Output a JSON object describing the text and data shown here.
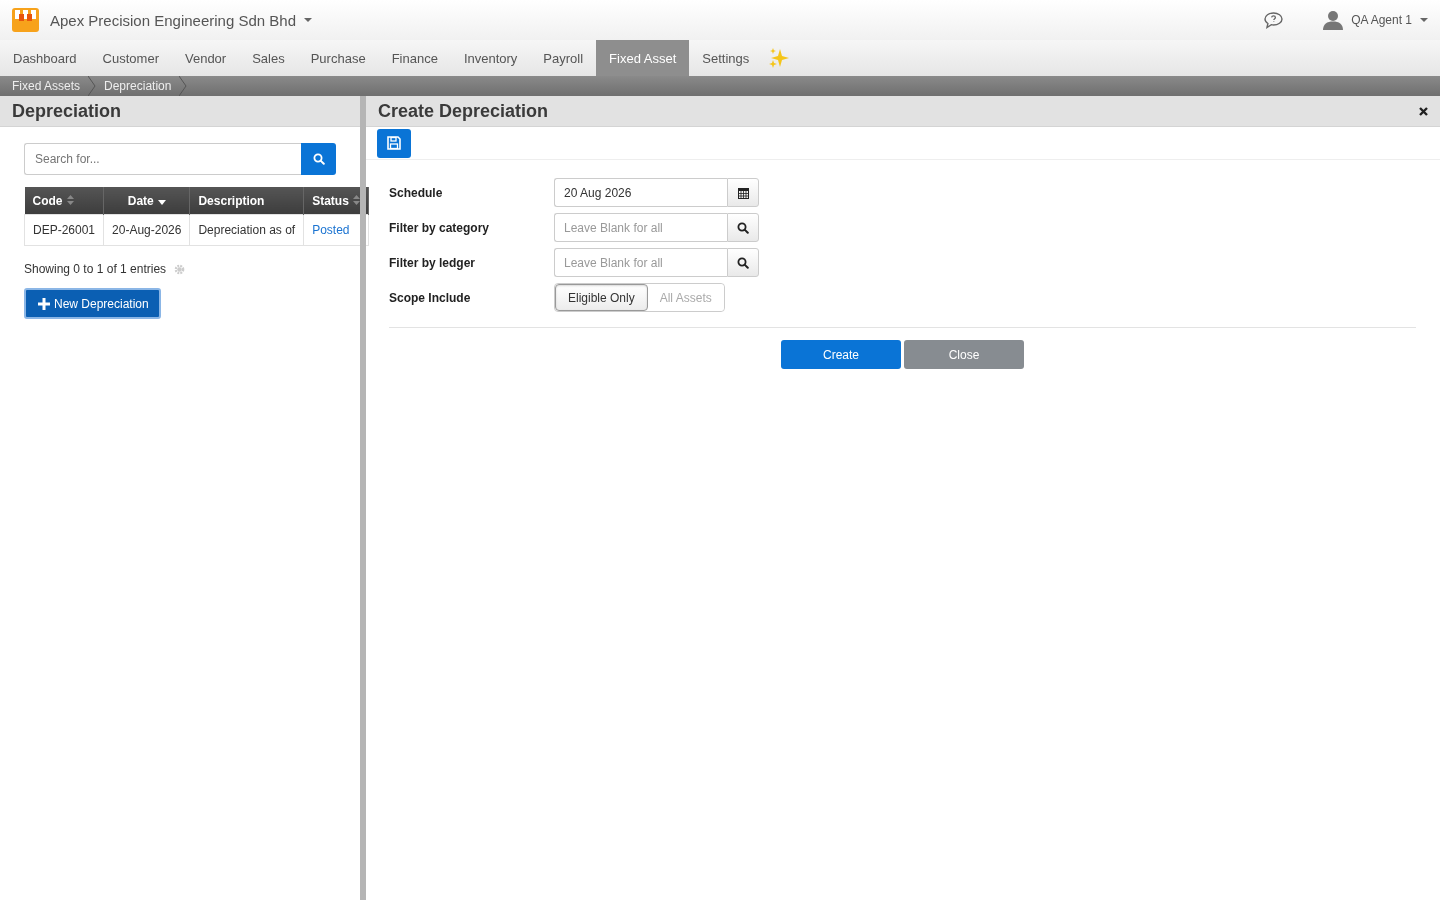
{
  "header": {
    "company": "Apex Precision Engineering Sdn Bhd",
    "user": "QA Agent 1"
  },
  "nav": [
    {
      "label": "Dashboard",
      "selected": false
    },
    {
      "label": "Customer",
      "selected": false
    },
    {
      "label": "Vendor",
      "selected": false
    },
    {
      "label": "Sales",
      "selected": false
    },
    {
      "label": "Purchase",
      "selected": false
    },
    {
      "label": "Finance",
      "selected": false
    },
    {
      "label": "Inventory",
      "selected": false
    },
    {
      "label": "Payroll",
      "selected": false
    },
    {
      "label": "Fixed Asset",
      "selected": true
    },
    {
      "label": "Settings",
      "selected": false
    }
  ],
  "breadcrumb": [
    "Fixed Assets",
    "Depreciation"
  ],
  "list_panel": {
    "title": "Depreciation",
    "search": {
      "placeholder": "Search for..."
    },
    "table": {
      "columns": [
        {
          "label": "Code",
          "sortable": true,
          "sorted_desc": false
        },
        {
          "label": "Date",
          "sortable": true,
          "sorted_desc": true
        },
        {
          "label": "Description",
          "sortable": false
        },
        {
          "label": "Status",
          "sortable": true,
          "sorted_desc": false
        }
      ],
      "rows": [
        {
          "cells": [
            "DEP-26001",
            "20-Aug-2026",
            "Depreciation as of",
            "Posted"
          ]
        }
      ]
    },
    "info": "Showing 0 to 1 of 1 entries",
    "new_button": "New Depreciation"
  },
  "form_panel": {
    "title": "Create Depreciation",
    "fields": [
      {
        "kind": "date",
        "label": "Schedule",
        "value": "20 Aug 2026"
      },
      {
        "kind": "lookup",
        "label": "Filter by category",
        "placeholder": "Leave Blank for all"
      },
      {
        "kind": "lookup",
        "label": "Filter by ledger",
        "placeholder": "Leave Blank for all"
      },
      {
        "kind": "toggle",
        "label": "Scope Include",
        "options": [
          {
            "label": "Eligible Only",
            "selected": true
          },
          {
            "label": "All Assets",
            "selected": false
          }
        ]
      }
    ],
    "buttons": [
      {
        "label": "Create",
        "kind": "primary"
      },
      {
        "label": "Close",
        "kind": "secondary"
      }
    ]
  }
}
